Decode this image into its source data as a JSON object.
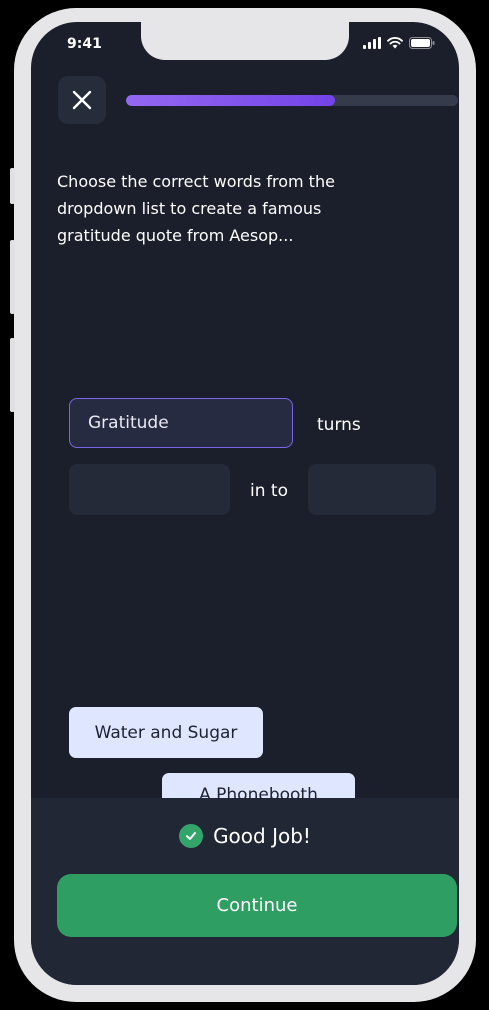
{
  "status_bar": {
    "time": "9:41",
    "icons": [
      "signal-icon",
      "wifi-icon",
      "battery-icon"
    ]
  },
  "header": {
    "close_icon": "close-icon",
    "progress_fraction": 0.63
  },
  "question": {
    "instruction": "Choose the correct words from the dropdown list to create a famous gratitude quote from Aesop..."
  },
  "quote": {
    "slot1_value": "Gratitude",
    "word1": "turns",
    "slot2_value": "",
    "word2": "in to",
    "slot3_value": ""
  },
  "options": [
    {
      "label": "Water and Sugar"
    },
    {
      "label": "A Phonebooth"
    }
  ],
  "feedback": {
    "message": "Good Job!",
    "icon": "check-circle-icon",
    "continue_label": "Continue"
  },
  "colors": {
    "background": "#1b1f2b",
    "accent": "#7a66e6",
    "success": "#2f9e63",
    "chip": "#dfe6ff"
  }
}
